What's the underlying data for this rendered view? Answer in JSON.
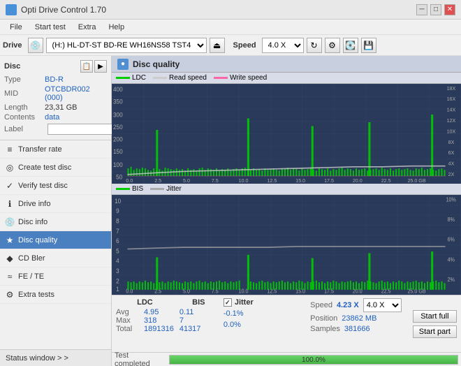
{
  "titlebar": {
    "title": "Opti Drive Control 1.70",
    "icon": "●",
    "minimize_label": "─",
    "maximize_label": "□",
    "close_label": "✕"
  },
  "menubar": {
    "items": [
      {
        "id": "file",
        "label": "File"
      },
      {
        "id": "start_test",
        "label": "Start test"
      },
      {
        "id": "extra",
        "label": "Extra"
      },
      {
        "id": "help",
        "label": "Help"
      }
    ]
  },
  "toolbar": {
    "drive_label": "Drive",
    "drive_value": "(H:)  HL-DT-ST BD-RE  WH16NS58 TST4",
    "speed_label": "Speed",
    "speed_value": "4.0 X"
  },
  "disc_panel": {
    "title": "Disc",
    "type_label": "Type",
    "type_value": "BD-R",
    "mid_label": "MID",
    "mid_value": "OTCBDR002 (000)",
    "length_label": "Length",
    "length_value": "23,31 GB",
    "contents_label": "Contents",
    "contents_value": "data",
    "label_label": "Label",
    "label_value": ""
  },
  "nav": {
    "items": [
      {
        "id": "transfer_rate",
        "label": "Transfer rate",
        "icon": "≡"
      },
      {
        "id": "create_test_disc",
        "label": "Create test disc",
        "icon": "◎"
      },
      {
        "id": "verify_test_disc",
        "label": "Verify test disc",
        "icon": "✓"
      },
      {
        "id": "drive_info",
        "label": "Drive info",
        "icon": "ℹ"
      },
      {
        "id": "disc_info",
        "label": "Disc info",
        "icon": "💿"
      },
      {
        "id": "disc_quality",
        "label": "Disc quality",
        "icon": "★",
        "active": true
      },
      {
        "id": "cd_bler",
        "label": "CD Bler",
        "icon": "◆"
      },
      {
        "id": "fe_te",
        "label": "FE / TE",
        "icon": "≈"
      },
      {
        "id": "extra_tests",
        "label": "Extra tests",
        "icon": "⚙"
      }
    ],
    "status_window_label": "Status window > >"
  },
  "disc_quality": {
    "title": "Disc quality",
    "legend": {
      "ldc_label": "LDC",
      "ldc_color": "#00aa00",
      "read_speed_label": "Read speed",
      "read_speed_color": "#cccccc",
      "write_speed_label": "Write speed",
      "write_speed_color": "#ff66aa",
      "bis_label": "BIS",
      "bis_color": "#00aa00",
      "jitter_label": "Jitter",
      "jitter_color": "#cccccc"
    },
    "chart1": {
      "y_max": 400,
      "y_labels": [
        "400",
        "350",
        "300",
        "250",
        "200",
        "150",
        "100",
        "50"
      ],
      "y_right_labels": [
        "18X",
        "16X",
        "14X",
        "12X",
        "10X",
        "8X",
        "6X",
        "4X",
        "2X"
      ],
      "x_labels": [
        "0.0",
        "2.5",
        "5.0",
        "7.5",
        "10.0",
        "12.5",
        "15.0",
        "17.5",
        "20.0",
        "22.5",
        "25.0 GB"
      ]
    },
    "chart2": {
      "y_max": 10,
      "y_labels": [
        "10",
        "9",
        "8",
        "7",
        "6",
        "5",
        "4",
        "3",
        "2",
        "1"
      ],
      "y_right_labels": [
        "10%",
        "8%",
        "6%",
        "4%",
        "2%"
      ],
      "x_labels": [
        "0.0",
        "2.5",
        "5.0",
        "7.5",
        "10.0",
        "12.5",
        "15.0",
        "17.5",
        "20.0",
        "22.5",
        "25.0 GB"
      ]
    },
    "stats": {
      "ldc_header": "LDC",
      "bis_header": "BIS",
      "jitter_header": "Jitter",
      "jitter_checked": true,
      "avg_label": "Avg",
      "max_label": "Max",
      "total_label": "Total",
      "ldc_avg": "4.95",
      "ldc_max": "318",
      "ldc_total": "1891316",
      "bis_avg": "0.11",
      "bis_max": "7",
      "bis_total": "41317",
      "jitter_avg": "-0.1%",
      "jitter_max": "0.0%",
      "speed_label": "Speed",
      "speed_value": "4.23 X",
      "speed_select": "4.0 X",
      "position_label": "Position",
      "position_value": "23862 MB",
      "samples_label": "Samples",
      "samples_value": "381666",
      "start_full_label": "Start full",
      "start_part_label": "Start part"
    }
  },
  "progress": {
    "label": "Test completed",
    "percent": 100,
    "percent_label": "100.0%"
  },
  "colors": {
    "chart_bg": "#2a3a5a",
    "chart_grid": "#3a4a6a",
    "ldc_bar": "#00cc00",
    "bis_bar": "#00cc00",
    "read_speed_line": "#bbbbbb",
    "accent_blue": "#2060c0"
  }
}
